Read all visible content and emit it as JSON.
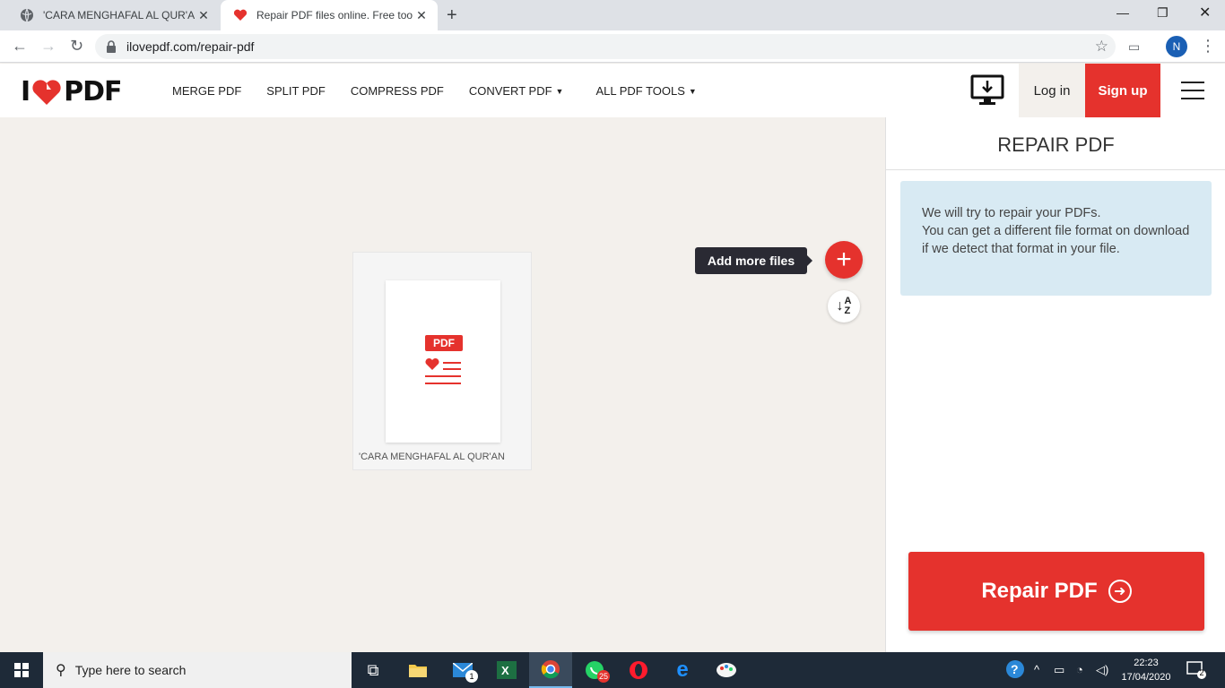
{
  "browser": {
    "tabs": [
      {
        "title": "'CARA MENGHAFAL AL QUR'AN DAL",
        "active": false
      },
      {
        "title": "Repair PDF files online. Free tool",
        "active": true
      }
    ],
    "url": "ilovepdf.com/repair-pdf",
    "profile_initial": "N"
  },
  "site": {
    "logo_left": "I",
    "logo_right": "PDF",
    "nav": [
      "MERGE PDF",
      "SPLIT PDF",
      "COMPRESS PDF",
      "CONVERT PDF",
      "ALL PDF TOOLS"
    ],
    "login": "Log in",
    "signup": "Sign up",
    "brand_color": "#e5322d"
  },
  "workspace": {
    "file_name": "'CARA MENGHAFAL AL QUR'AN",
    "file_badge": "PDF",
    "tooltip": "Add more files",
    "sort_label_top": "A",
    "sort_label_bottom": "Z"
  },
  "sidebar": {
    "title": "REPAIR PDF",
    "info_line1": "We will try to repair your PDFs.",
    "info_line2": "You can get a different file format on download if we detect that format in your file.",
    "action": "Repair PDF"
  },
  "taskbar": {
    "search_placeholder": "Type here to search",
    "mail_badge": "1",
    "whatsapp_badge": "25",
    "time": "22:23",
    "date": "17/04/2020",
    "notifications": "2"
  }
}
